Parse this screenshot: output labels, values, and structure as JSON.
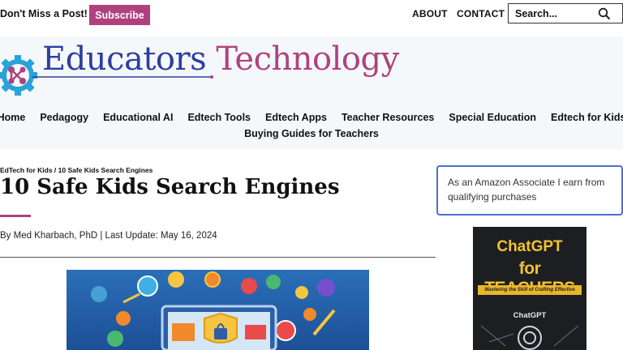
{
  "topbar": {
    "dont_miss": "Don't Miss a Post!",
    "subscribe_label": "Subscribe",
    "about_label": "ABOUT",
    "contact_label": "CONTACT",
    "search_placeholder": "Search..."
  },
  "logo": {
    "part1": "Educators",
    "part2": "Technology"
  },
  "nav": {
    "row1": [
      "Home",
      "Pedagogy",
      "Educational AI",
      "Edtech Tools",
      "Edtech Apps",
      "Teacher Resources",
      "Special Education",
      "Edtech for Kids"
    ],
    "row2": [
      "Buying Guides for Teachers"
    ]
  },
  "article": {
    "breadcrumb": "EdTech for Kids / 10 Safe Kids Search Engines",
    "title": "10 Safe Kids Search Engines",
    "byline": "By Med Kharbach, PhD | Last Update: May 16, 2024"
  },
  "sidebar": {
    "amazon_notice": "As an Amazon Associate I earn from qualifying purchases",
    "book": {
      "title_line1": "ChatGPT",
      "title_line2": "for TEACHERS",
      "subtitle": "Mastering the Skill of Crafting Effective Prompts",
      "brand": "ChatGPT"
    }
  },
  "colors": {
    "accent": "#b0417e",
    "logo_blue": "#2e3e9e",
    "header_band": "#f4f8fa",
    "amazon_border": "#4a6fd6"
  }
}
